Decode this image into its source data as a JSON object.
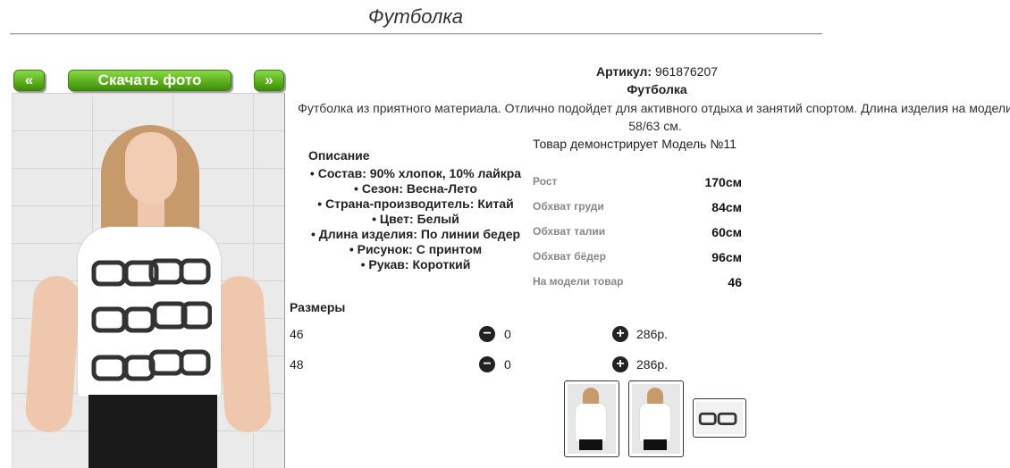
{
  "page": {
    "title": "Футболка"
  },
  "nav": {
    "prev_label": "«",
    "download_label": "Скачать фото",
    "next_label": "»"
  },
  "product": {
    "article_label": "Артикул:",
    "article_value": "961876207",
    "name": "Футболка",
    "description": "Футболка из приятного материала. Отлично подойдет для активного отдыха и занятий спортом. Длина изделия на модели 58/63 см.",
    "model_note": "Товар демонстрирует Модель №11"
  },
  "description_section": {
    "heading": "Описание",
    "items": [
      "Состав: 90% хлопок, 10% лайкра",
      "Сезон: Весна-Лето",
      "Страна-производитель: Китай",
      "Цвет: Белый",
      "Длина изделия: По линии бедер",
      "Рисунок: С принтом",
      "Рукав: Короткий"
    ]
  },
  "measurements": [
    {
      "label": "Рост",
      "value": "170см"
    },
    {
      "label": "Обхват груди",
      "value": "84см"
    },
    {
      "label": "Обхват талии",
      "value": "60см"
    },
    {
      "label": "Обхват бёдер",
      "value": "96см"
    },
    {
      "label": "На модели товар",
      "value": "46"
    }
  ],
  "sizes": {
    "heading": "Размеры",
    "rows": [
      {
        "size": "46",
        "qty": "0",
        "price": "286р."
      },
      {
        "size": "48",
        "qty": "0",
        "price": "286р."
      }
    ],
    "minus_icon": "minus-circle-icon",
    "plus_icon": "plus-circle-icon"
  }
}
